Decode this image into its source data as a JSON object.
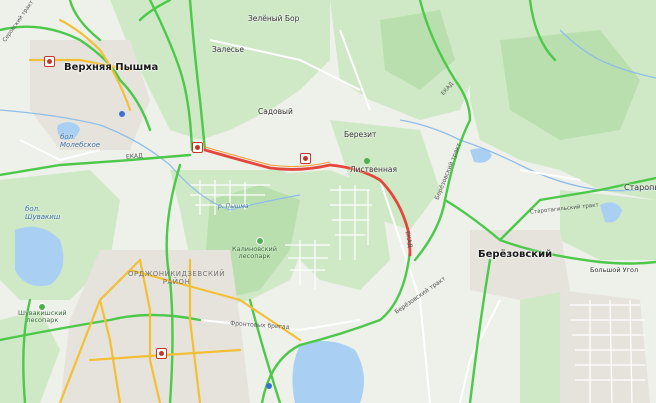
{
  "map": {
    "towns": {
      "verkhnyaya_pyshma": "Верхняя Пышма",
      "beryozovsky": "Берёзовский",
      "staropyshminsk": "Старопышм"
    },
    "villages": {
      "zelyony_bor": "Зелёный Бор",
      "zalesye": "Залесье",
      "sadovy": "Садовый",
      "berezit": "Березит",
      "listvennaya": "Лиственная",
      "bolshoy_ugol": "Большой Угол"
    },
    "water": {
      "molebskoe": "бол.\nМолебское",
      "shuvakish": "бол.\nШувакиш",
      "pyshma_river": "р. Пышма"
    },
    "districts": {
      "ordzhonikidzevsky": "ОРДЖОНИКИДЗЕВСКИЙ\nРАЙОН"
    },
    "parks": {
      "kalinovsky": "Калиновский\nлесопарк",
      "shuvakishsky": "Шувакишский\nлесопарк"
    },
    "roads": {
      "ekad": "ЕКАД",
      "ekad2": "ЕКАД",
      "serovsky": "Серовский тракт",
      "beryozovsky_trakt": "Берёзовский тракт",
      "beryozovsky_trakt2": "Берёзовский тракт",
      "frontovykh_brigad": "Фронтовых бригад",
      "starobereozovskaya": "Старотагильский тракт",
      "ekad3": "ЕКАД"
    },
    "colors": {
      "forest": "#c7e6bf",
      "traffic_green": "#4cc84a",
      "traffic_red": "#e3473c",
      "traffic_yellow": "#f2c037",
      "water": "#a9cff2"
    }
  }
}
